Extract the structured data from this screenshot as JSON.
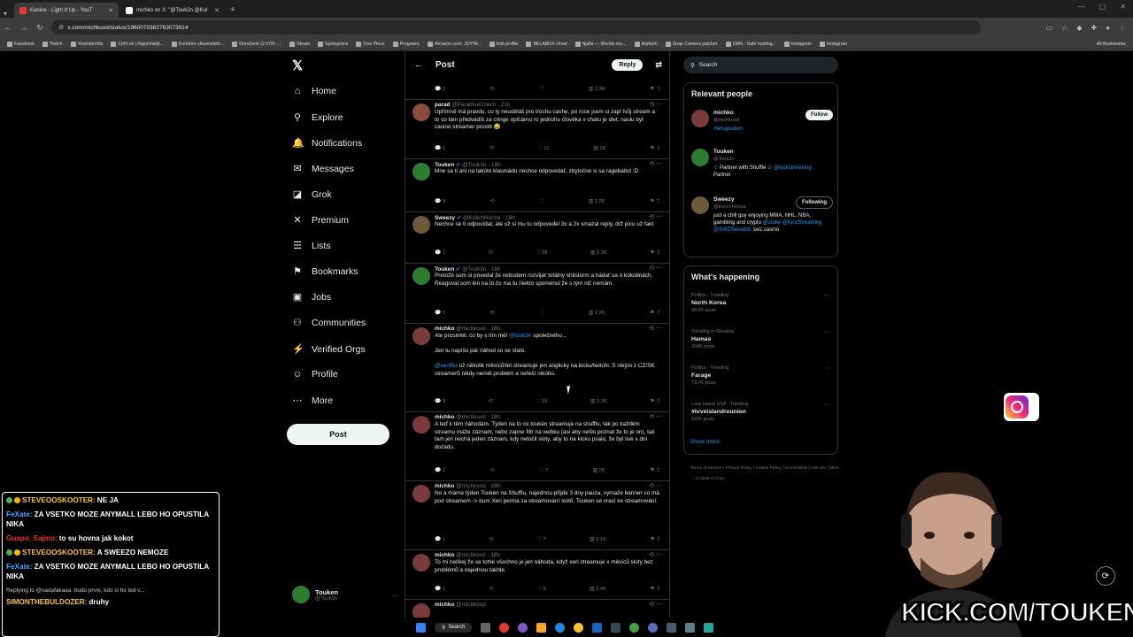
{
  "browser": {
    "tabs": [
      {
        "title": "Kanine - Light It Up - YouT",
        "favicon_color": "#e53935",
        "active": true
      },
      {
        "title": "michko on X: \"@Touk3n @Kul",
        "favicon_color": "#ffffff",
        "active": false
      }
    ],
    "url": "x.com/michkoxd/status/1960070382763073914",
    "bookmarks": [
      "Facebook",
      "Twitch",
      "YoutubeVids",
      "CtrlV.sk | Najrýchlejš...",
      "Korektor slovenskéh...",
      "Doručené (2 678) -...",
      "Steam",
      "Spolupráce",
      "One Piece",
      "Programy",
      "Amazon.com: JOYIN...",
      "Edit profile",
      "BELABOX cloud",
      "Njalla — Worlds mo...",
      "klipfarm",
      "Snap Camera patcher",
      "1984 - Safe hosting...",
      "Instagram",
      "Instagram"
    ],
    "all_bookmarks": "All Bookmarks"
  },
  "nav": {
    "items": [
      {
        "label": "Home",
        "icon": "⌂"
      },
      {
        "label": "Explore",
        "icon": "⚲"
      },
      {
        "label": "Notifications",
        "icon": "🔔"
      },
      {
        "label": "Messages",
        "icon": "✉"
      },
      {
        "label": "Grok",
        "icon": "◪"
      },
      {
        "label": "Premium",
        "icon": "✕"
      },
      {
        "label": "Lists",
        "icon": "☰"
      },
      {
        "label": "Bookmarks",
        "icon": "⚑"
      },
      {
        "label": "Jobs",
        "icon": "▣"
      },
      {
        "label": "Communities",
        "icon": "⚇"
      },
      {
        "label": "Verified Orgs",
        "icon": "⚡"
      },
      {
        "label": "Profile",
        "icon": "☺"
      },
      {
        "label": "More",
        "icon": "⋯"
      }
    ],
    "post_label": "Post",
    "me": {
      "name": "Touken",
      "handle": "@Touk3n"
    }
  },
  "center": {
    "title": "Post",
    "reply_label": "Reply",
    "tweets": [
      {
        "name": "",
        "handle": "",
        "time": "",
        "text": "",
        "actions": [
          "2",
          "",
          "",
          "2.2K"
        ],
        "color": "#555"
      },
      {
        "name": "parad",
        "handle": "@ParadiseCzech",
        "time": "21h",
        "verified": false,
        "text": "Upřímně má pravdu, co ty neuděláš pro trochu cashe, po roce jsem si zapl tvůj stream a to co tam předvádíš za cringe opičárnu ro jednoho človéka v chatu je úlet, naslu byt casino streamer prostě 😂",
        "actions": [
          "1",
          "",
          "11",
          "2K"
        ],
        "color": "#8a4b3c"
      },
      {
        "name": "Touken",
        "handle": "@Touk3n",
        "time": "18h",
        "verified": true,
        "text": "Mne sa ti ani na takúto klauniádu nechce odpovedať, zbytočne si sa ragebaitol :D",
        "actions": [
          "3",
          "",
          "",
          "2.2K"
        ],
        "color": "#2e7d32"
      },
      {
        "name": "Sweezy",
        "handle": "@KulichHonza",
        "time": "18h",
        "verified": true,
        "text": "Nechce se ti odpovídat, ale už si mu tu odpovedel 3x a 2x smazal reply, drž picu už fakt",
        "actions": [
          "1",
          "",
          "28",
          "2.3K"
        ],
        "color": "#6d5a3a"
      },
      {
        "name": "Touken",
        "handle": "@Touk3n",
        "time": "18h",
        "verified": true,
        "text": "Pretože som si povedal že nebudem rozvíjať totálny shitstorm a hádať sa o kokotinách. Reagoval som len na to čo ma tu niekto spomenul že s tým nič nemám.",
        "actions": [
          "1",
          "",
          "",
          "2.2K"
        ],
        "color": "#2e7d32"
      },
      {
        "name": "michko",
        "handle": "@michkoxd",
        "time": "18h",
        "verified": false,
        "text": "Ale prosimtě, co by s tím měl @touk3n společného...\n\nJen tu napíšu pár náhod co se stalo.\n\n@xeriffer už několik měsíců/let streamuje jen anglicky na kicku/twitchi. S nikým z CZ/SK streamerů nikdy neměl problém a neřeší nikoho.",
        "actions": [
          "3",
          "",
          "10",
          "2.3K"
        ],
        "color": "#7a3b3b"
      },
      {
        "name": "michko",
        "handle": "@michkoxd",
        "time": "18h",
        "verified": false,
        "text": "A teď k těm náhodám. Týden na to co touken streamuje na shufflu, tak po každém streamu maže záznam, nebo zapne filtr  na webku (asi aby nešlo poznat že to je on), tak tam jen nechá jeden záznam, kdy netočil sloty, aby to na kicku psalo, že byl live x dní dozadu.",
        "actions": [
          "1",
          "",
          "7",
          "2K"
        ],
        "color": "#7a3b3b"
      },
      {
        "name": "michko",
        "handle": "@michkoxd",
        "time": "18h",
        "verified": false,
        "text": "No a máme týden Touken na Shufflu, najednou příjde 3 dny pauza, vymaže banner co má pod streamem -> bum Xeri perma za streamování slotů, Touken se vrací ke streamování.",
        "actions": [
          "1",
          "",
          "7",
          "2.1K"
        ],
        "color": "#7a3b3b"
      },
      {
        "name": "michko",
        "handle": "@michkoxd",
        "time": "18h",
        "verified": false,
        "text": "To mi nelíkej že se tohle všechno je jen náhoda, když xeri streamuje x měsíců sloty bez problémů a najednou takhle.",
        "actions": [
          "1",
          "",
          "9",
          "2.4K"
        ],
        "color": "#7a3b3b"
      },
      {
        "name": "michko",
        "handle": "@michkoxd",
        "time": "",
        "verified": false,
        "text": "",
        "actions": [
          "",
          "",
          "",
          ""
        ],
        "color": "#7a3b3b"
      }
    ]
  },
  "right": {
    "search_placeholder": "Search",
    "relevant_title": "Relevant people",
    "people": [
      {
        "name": "michko",
        "handle": "@michkoxd",
        "bio": "#letsgoollers",
        "button": "Follow",
        "color": "#7a3b3b"
      },
      {
        "name": "Touken",
        "handle": "@Touk3n",
        "bio": "♢ Partner with Shuffle ♤ @kickstreaming Partner",
        "button": "",
        "color": "#2e7d32"
      },
      {
        "name": "Sweezy",
        "handle": "@KulichHonza",
        "bio": "just a chill guy enjoying MMA, NHL, NBA, gambling and crypto @stake @KickStreaming @SWZRewards swz.casino",
        "button": "Following",
        "color": "#6d5a3a"
      }
    ],
    "happening_title": "What's happening",
    "trends": [
      {
        "category": "Politics · Trending",
        "title": "North Korea",
        "posts": "48.2K posts"
      },
      {
        "category": "Trending in Slovakia",
        "title": "Hamas",
        "posts": "264K posts"
      },
      {
        "category": "Politics · Trending",
        "title": "Farage",
        "posts": "73.7K posts"
      },
      {
        "category": "Love Island USA · Trending",
        "title": "#loveislandreunion",
        "posts": "116K posts"
      }
    ],
    "show_more": "Show more",
    "footer": "Terms of Service  |  Privacy Policy  |  Cookie Policy  |  Accessibility  |  Ads info  |  More ···  © 2025 X Corp."
  },
  "chat": {
    "lines": [
      {
        "user": "STEVEOOSKOOTER:",
        "msg": "NE JA",
        "color": "#f5c542",
        "badge": true
      },
      {
        "user": "FeXate:",
        "msg": "ZA VSETKO MOZE ANYMALL LEBO HO OPUSTILA NIKA",
        "color": "#4aa3ff",
        "badge": false
      },
      {
        "user": "Guapo_Sajmo:",
        "msg": "to su hovna jak kokot",
        "color": "#e53935",
        "badge": false
      },
      {
        "user": "STEVEOOSKOOTER:",
        "msg": "A SWEEZO NEMOZE",
        "color": "#f5c542",
        "badge": true
      },
      {
        "user": "FeXate:",
        "msg": "ZA VSETKO MOZE ANYMALL LEBO HO OPUSTILA NIKA",
        "color": "#4aa3ff",
        "badge": false
      }
    ],
    "reply_context": "Replying to @sadafakaaa: budu prvni, kdo si ho ted v...",
    "last": {
      "user": "SIMONTHEBULDOZER:",
      "msg": "druhy",
      "color": "#f5c542"
    }
  },
  "overlay": {
    "kick_text": "KICK.COM/TOUKEN"
  },
  "taskbar": {
    "search_label": "Search"
  }
}
